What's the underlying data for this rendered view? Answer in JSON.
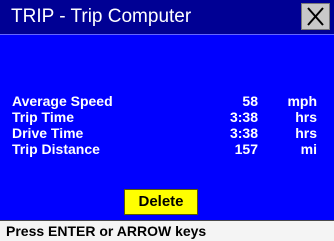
{
  "window": {
    "title": "TRIP - Trip Computer",
    "close_icon": "close-icon"
  },
  "stats": [
    {
      "label": "Average Speed",
      "value": "58",
      "unit": "mph"
    },
    {
      "label": "Trip Time",
      "value": "3:38",
      "unit": "hrs"
    },
    {
      "label": "Drive Time",
      "value": "3:38",
      "unit": "hrs"
    },
    {
      "label": "Trip Distance",
      "value": "157",
      "unit": "mi"
    }
  ],
  "actions": {
    "delete_label": "Delete"
  },
  "status": {
    "text": "Press ENTER or ARROW keys"
  },
  "colors": {
    "background": "#0000ff",
    "titlebar": "#000094",
    "button": "#ffff00",
    "text": "#ffffff"
  }
}
